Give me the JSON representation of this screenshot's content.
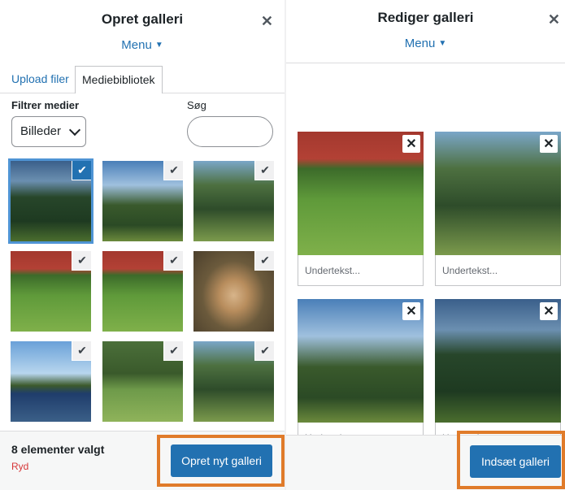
{
  "left": {
    "title": "Opret galleri",
    "menu_label": "Menu",
    "tabs": [
      "Upload filer",
      "Mediebibliotek"
    ],
    "filter_label": "Filtrer medier",
    "filter_value": "Billeder",
    "search_label": "Søg",
    "search_value": "",
    "selection_count": "8 elementer valgt",
    "clear_label": "Ryd",
    "create_button": "Opret nyt galleri"
  },
  "right": {
    "title": "Rediger galleri",
    "menu_label": "Menu",
    "caption_placeholder": "Undertekst...",
    "insert_button": "Indsæt galleri"
  },
  "icons": {
    "close": "close-icon",
    "caret": "caret-down-icon",
    "check": "check-icon",
    "remove": "remove-icon"
  },
  "colors": {
    "accent": "#2271b1",
    "highlight": "#e07b2a",
    "clear": "#d63638"
  }
}
